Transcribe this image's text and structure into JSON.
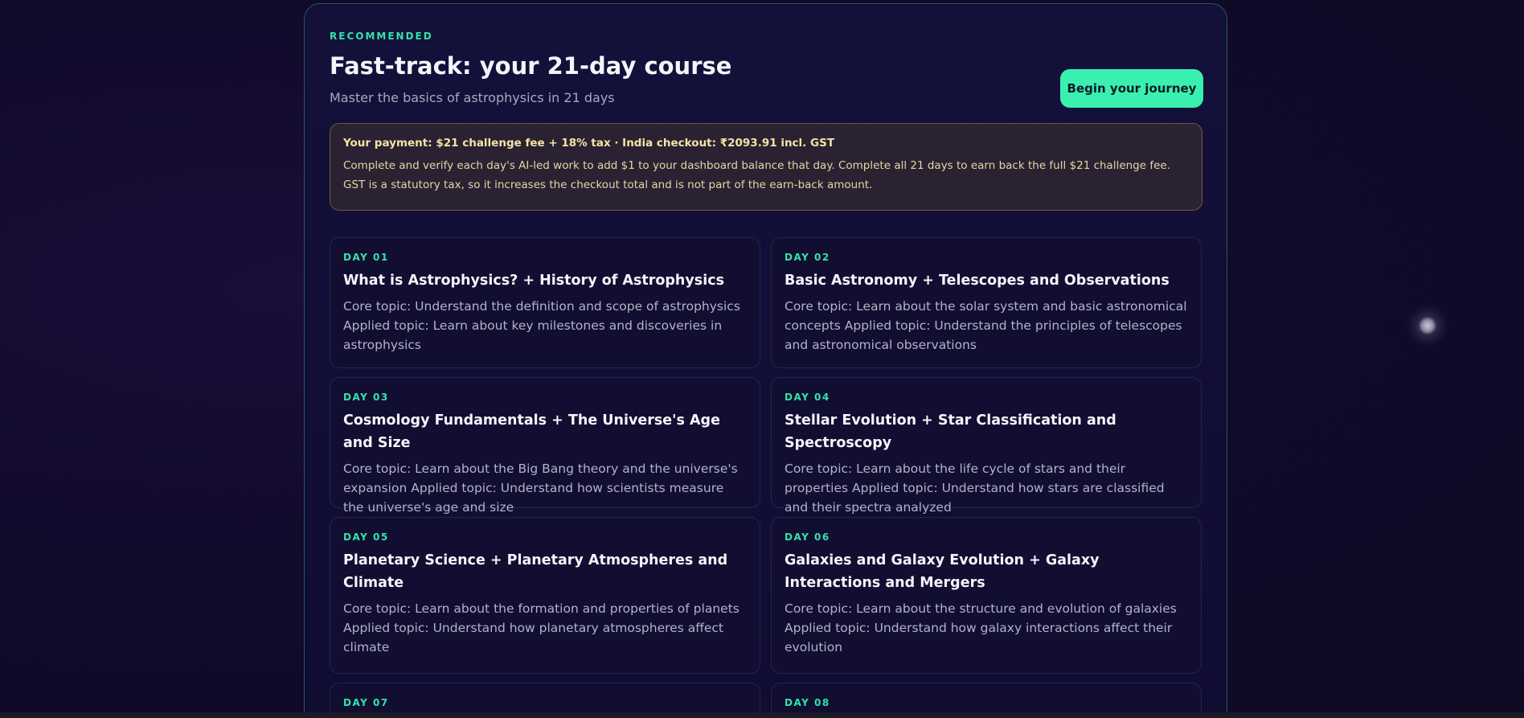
{
  "course": {
    "kicker": "RECOMMENDED",
    "title": "Fast-track: your 21-day course",
    "subtitle": "Master the basics of astrophysics in 21 days",
    "cta_label": "Begin your journey"
  },
  "payment": {
    "headline": "Your payment: $21 challenge fee + 18% tax · India checkout: ₹2093.91 incl. GST",
    "body": "Complete and verify each day's AI-led work to add $1 to your dashboard balance that day. Complete all 21 days to earn back the full $21 challenge fee. GST is a statutory tax, so it increases the checkout total and is not part of the earn-back amount."
  },
  "days": [
    {
      "label": "DAY 01",
      "title": "What is Astrophysics? + History of Astrophysics",
      "description": "Core topic: Understand the definition and scope of astrophysics Applied topic: Learn about key milestones and discoveries in astrophysics"
    },
    {
      "label": "DAY 02",
      "title": "Basic Astronomy + Telescopes and Observations",
      "description": "Core topic: Learn about the solar system and basic astronomical concepts Applied topic: Understand the principles of telescopes and astronomical observations"
    },
    {
      "label": "DAY 03",
      "title": "Cosmology Fundamentals + The Universe's Age and Size",
      "description": "Core topic: Learn about the Big Bang theory and the universe's expansion Applied topic: Understand how scientists measure the universe's age and size"
    },
    {
      "label": "DAY 04",
      "title": "Stellar Evolution + Star Classification and Spectroscopy",
      "description": "Core topic: Learn about the life cycle of stars and their properties Applied topic: Understand how stars are classified and their spectra analyzed"
    },
    {
      "label": "DAY 05",
      "title": "Planetary Science + Planetary Atmospheres and Climate",
      "description": "Core topic: Learn about the formation and properties of planets Applied topic: Understand how planetary atmospheres affect climate"
    },
    {
      "label": "DAY 06",
      "title": "Galaxies and Galaxy Evolution + Galaxy Interactions and Mergers",
      "description": "Core topic: Learn about the structure and evolution of galaxies Applied topic: Understand how galaxy interactions affect their evolution"
    },
    {
      "label": "DAY 07",
      "title": "",
      "description": ""
    },
    {
      "label": "DAY 08",
      "title": "",
      "description": ""
    }
  ]
}
